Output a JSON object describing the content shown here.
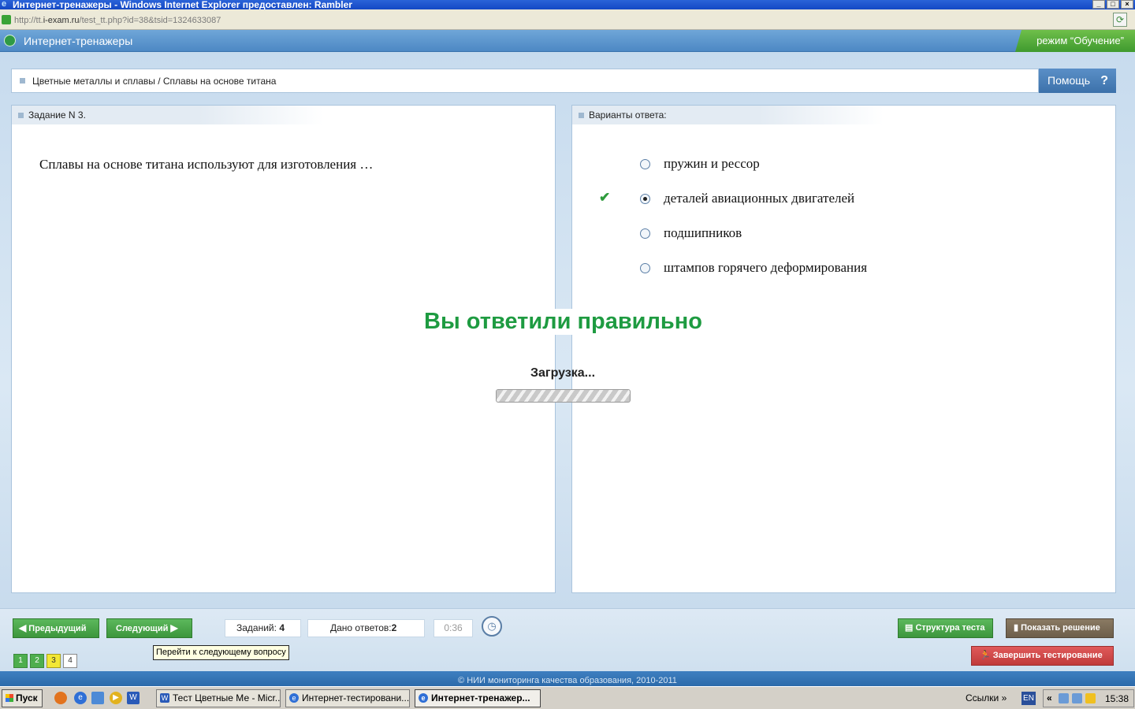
{
  "window": {
    "title": "Интернет-тренажеры - Windows Internet Explorer предоставлен: Rambler",
    "controls": [
      "_",
      "□",
      "×"
    ],
    "url_prefix": "http://tt.",
    "url_domain": "i-exam.ru",
    "url_path": "/test_tt.php?id=38&tsid=1324633087"
  },
  "header": {
    "app_title": "Интернет-тренажеры",
    "mode": "режим “Обучение”"
  },
  "breadcrumb": "Цветные металлы и сплавы / Сплавы на основе титана",
  "help": {
    "label": "Помощь",
    "icon": "?"
  },
  "task": {
    "title": "Задание N 3.",
    "question": "Сплавы на основе титана используют для изготовления …"
  },
  "answers": {
    "title": "Варианты ответа:",
    "options": [
      {
        "label": "пружин и рессор",
        "selected": false
      },
      {
        "label": "деталей авиационных двигателей",
        "selected": true
      },
      {
        "label": "подшипников",
        "selected": false
      },
      {
        "label": "штампов горячего деформирования",
        "selected": false
      }
    ]
  },
  "feedback": {
    "result": "Вы ответили правильно",
    "loading": "Загрузка..."
  },
  "toolbar": {
    "prev": "Предыдущий",
    "next": "Следующий",
    "tasks_label": "Заданий:",
    "tasks_count": "4",
    "answers_label": "Дано ответов:",
    "answers_count": "2",
    "timer": "0:36",
    "tooltip": "Перейти к следующему вопросу",
    "structure": "Структура теста",
    "show_solution": "Показать решение",
    "finish": "Завершить тестирование",
    "pages": [
      {
        "label": "1",
        "state": "done"
      },
      {
        "label": "2",
        "state": "done"
      },
      {
        "label": "3",
        "state": "current"
      },
      {
        "label": "4",
        "state": "blank"
      }
    ]
  },
  "footer": "© НИИ мониторинга качества образования, 2010-2011",
  "taskbar": {
    "start": "Пуск",
    "tasks": [
      {
        "label": "Тест Цветные Ме - Micr...",
        "active": false
      },
      {
        "label": "Интернет-тестировани...",
        "active": false
      },
      {
        "label": "Интернет-тренажер...",
        "active": true
      }
    ],
    "links": "Ссылки",
    "links_more": "»",
    "lang": "EN",
    "tray_more": "«",
    "time": "15:38"
  },
  "colors": {
    "header_blue": "#4d88c4",
    "mode_green": "#3f9a2f",
    "correct_green": "#1e9b41",
    "button_green": "#3c963c",
    "finish_red": "#c03b3b",
    "solution_brown": "#6d5e4a"
  }
}
